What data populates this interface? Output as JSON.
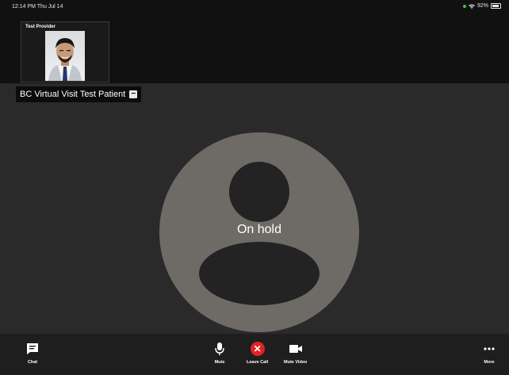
{
  "status_bar": {
    "time": "12:14 PM  Thu Jul 14",
    "battery": "92%"
  },
  "provider": {
    "name": "Test Provider"
  },
  "patient": {
    "name": "BC Virtual Visit Test Patient",
    "minimize_label": "−"
  },
  "call": {
    "status": "On hold"
  },
  "toolbar": {
    "chat": "Chat",
    "mute": "Mute",
    "leave_call": "Leave Call",
    "mute_video": "Mute Video",
    "more": "More"
  },
  "colors": {
    "leave": "#e02424",
    "avatar": "#6e6a66",
    "background": "#2a2a2a"
  }
}
